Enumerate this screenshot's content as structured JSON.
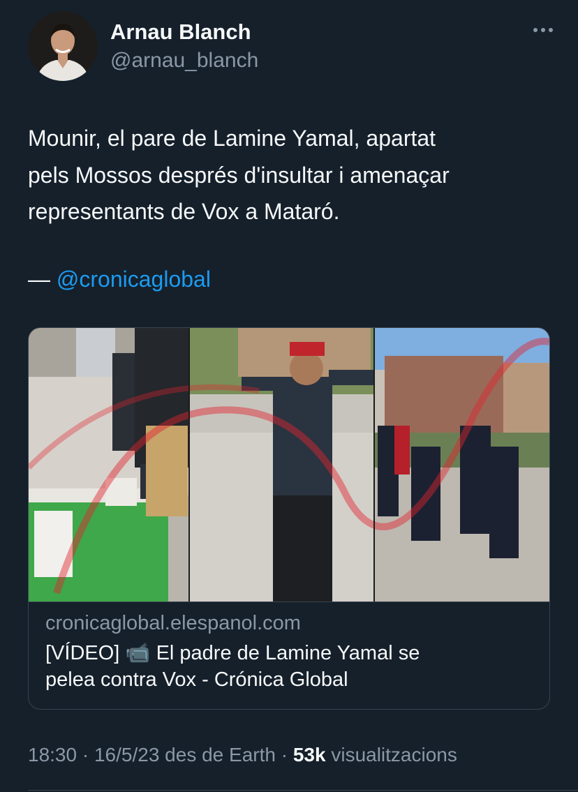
{
  "author": {
    "name": "Arnau Blanch",
    "handle": "@arnau_blanch"
  },
  "tweet": {
    "lines": [
      "Mounir, el pare de Lamine Yamal, apartat",
      "pels Mossos després d'insultar i amenaçar",
      "representants de Vox a Mataró."
    ],
    "credit_prefix": "— ",
    "credit_mention": "@cronicaglobal"
  },
  "card": {
    "image_icon": "news-photo-collage",
    "domain": "cronicaglobal.elespanol.com",
    "title_line1": "[VÍDEO] 📹 El padre de Lamine Yamal se",
    "title_line2": "pelea contra Vox - Crónica Global"
  },
  "meta": {
    "time": "18:30",
    "sep1": " · ",
    "date": "16/5/23 des de Earth",
    "sep2": " · ",
    "views_count": "53k",
    "views_label": " visualitzacions"
  },
  "icons": {
    "more": "more-horizontal-icon"
  },
  "colors": {
    "background": "#15202b",
    "text": "#f7f9f9",
    "muted": "#8b98a5",
    "link": "#1d9bf0",
    "border": "#38444d"
  }
}
